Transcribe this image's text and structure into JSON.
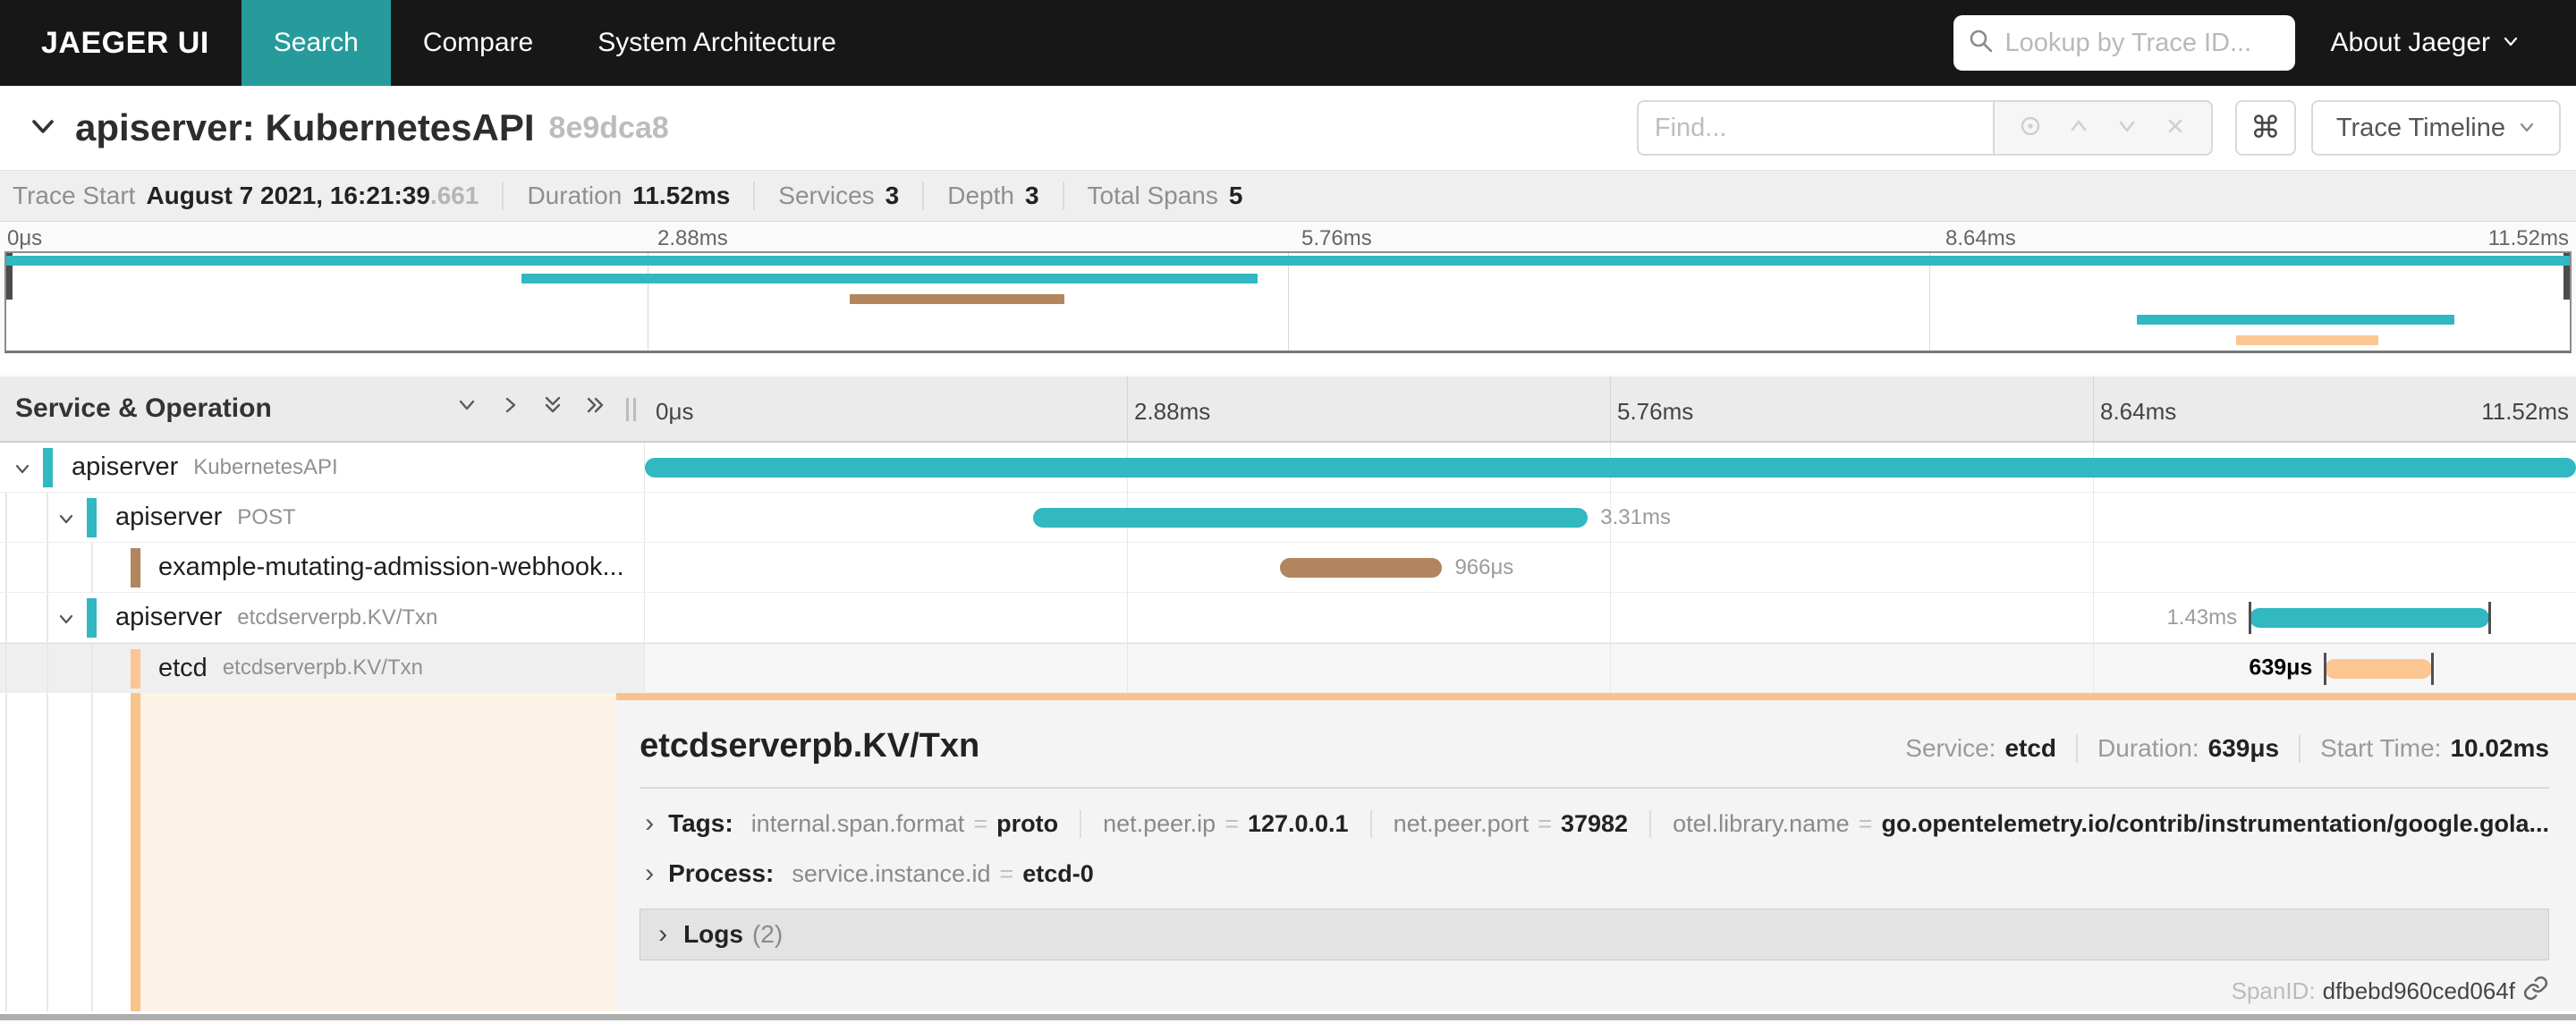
{
  "nav": {
    "brand": "JAEGER UI",
    "tabs": [
      {
        "label": "Search",
        "active": true
      },
      {
        "label": "Compare",
        "active": false
      },
      {
        "label": "System Architecture",
        "active": false
      }
    ],
    "trace_lookup_placeholder": "Lookup by Trace ID...",
    "about_label": "About Jaeger"
  },
  "trace_header": {
    "title": "apiserver: KubernetesAPI",
    "trace_id_short": "8e9dca8",
    "find_placeholder": "Find...",
    "view_selector_label": "Trace Timeline",
    "cmd_icon": "⌘"
  },
  "stats": {
    "items": [
      {
        "label": "Trace Start",
        "value": "August 7 2021, 16:21:39",
        "suffix": ".661"
      },
      {
        "label": "Duration",
        "value": "11.52ms",
        "suffix": ""
      },
      {
        "label": "Services",
        "value": "3",
        "suffix": ""
      },
      {
        "label": "Depth",
        "value": "3",
        "suffix": ""
      },
      {
        "label": "Total Spans",
        "value": "5",
        "suffix": ""
      }
    ]
  },
  "timeline": {
    "column_header": "Service & Operation",
    "ticks": [
      "0μs",
      "2.88ms",
      "5.76ms",
      "8.64ms",
      "11.52ms"
    ]
  },
  "spans": [
    {
      "service": "apiserver",
      "operation": "KubernetesAPI",
      "level": 0,
      "color": "teal",
      "start": 0,
      "width": 100,
      "duration_label": "",
      "label_side": "right",
      "ticks": false,
      "selected": false
    },
    {
      "service": "apiserver",
      "operation": "POST",
      "level": 1,
      "color": "teal",
      "start": 20.1,
      "width": 28.73,
      "duration_label": "3.31ms",
      "label_side": "right",
      "ticks": false,
      "selected": false
    },
    {
      "service": "example-mutating-admission-webhook...",
      "operation": "",
      "level": 2,
      "color": "brown",
      "start": 32.9,
      "width": 8.39,
      "duration_label": "966μs",
      "label_side": "right",
      "ticks": false,
      "selected": false
    },
    {
      "service": "apiserver",
      "operation": "etcdserverpb.KV/Txn",
      "level": 1,
      "color": "teal",
      "start": 83.1,
      "width": 12.41,
      "duration_label": "1.43ms",
      "label_side": "left",
      "ticks": true,
      "selected": false
    },
    {
      "service": "etcd",
      "operation": "etcdserverpb.KV/Txn",
      "level": 2,
      "color": "peach",
      "start": 87.0,
      "width": 5.55,
      "duration_label": "639μs",
      "label_side": "left",
      "ticks": true,
      "selected": true
    }
  ],
  "detail": {
    "title": "etcdserverpb.KV/Txn",
    "meta": [
      {
        "label": "Service:",
        "value": "etcd"
      },
      {
        "label": "Duration:",
        "value": "639μs"
      },
      {
        "label": "Start Time:",
        "value": "10.02ms"
      }
    ],
    "tags_label": "Tags:",
    "tags": [
      {
        "key": "internal.span.format",
        "value": "proto"
      },
      {
        "key": "net.peer.ip",
        "value": "127.0.0.1"
      },
      {
        "key": "net.peer.port",
        "value": "37982"
      },
      {
        "key": "otel.library.name",
        "value": "go.opentelemetry.io/contrib/instrumentation/google.gola..."
      }
    ],
    "process_label": "Process:",
    "process": [
      {
        "key": "service.instance.id",
        "value": "etcd-0"
      }
    ],
    "logs_label": "Logs",
    "logs_count": "(2)",
    "span_id_label": "SpanID:",
    "span_id": "dfbebd960ced064f"
  },
  "colors": {
    "teal": "#31b8c0",
    "brown": "#b2855e",
    "peach": "#fbc691",
    "nav_active": "#279b9b",
    "selected_tint": "#fdf2e6",
    "detail_border": "#f9c28a"
  }
}
